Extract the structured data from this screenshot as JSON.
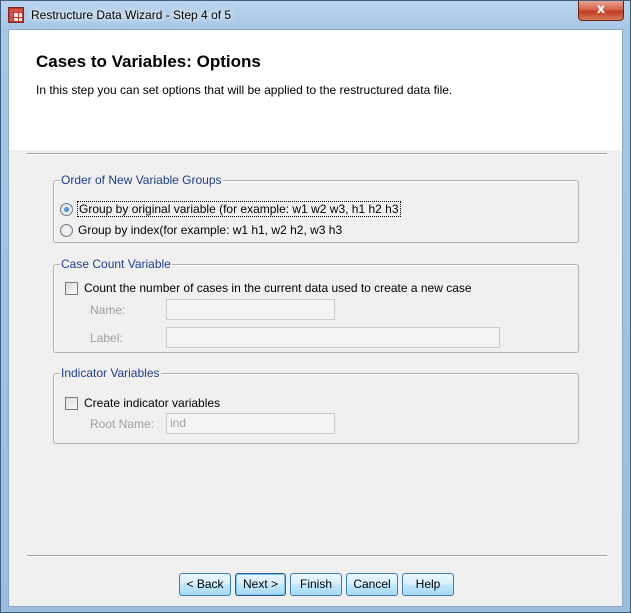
{
  "window": {
    "title": "Restructure Data Wizard - Step 4 of 5",
    "close_glyph": "x"
  },
  "header": {
    "heading": "Cases to Variables: Options",
    "description": "In this step you can set options that will be applied to the restructured data file."
  },
  "order_group": {
    "legend": "Order of New Variable Groups",
    "option_original": "Group by original variable (for example: w1 w2 w3, h1 h2 h3",
    "option_index": "Group by index(for example: w1 h1, w2 h2, w3 h3",
    "selected": "original"
  },
  "case_count_group": {
    "legend": "Case Count Variable",
    "checkbox_label": "Count the number of cases in the current data used to create a new case",
    "checked": false,
    "name_label": "Name:",
    "name_value": "",
    "label_label": "Label:",
    "label_value": ""
  },
  "indicator_group": {
    "legend": "Indicator Variables",
    "checkbox_label": "Create indicator variables",
    "checked": false,
    "root_name_label": "Root Name:",
    "root_name_value": "ind"
  },
  "buttons": {
    "back": "< Back",
    "next": "Next >",
    "finish": "Finish",
    "cancel": "Cancel",
    "help": "Help"
  }
}
